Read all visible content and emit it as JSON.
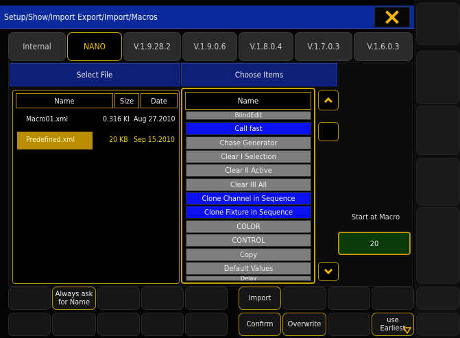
{
  "window": {
    "title": "Setup/Show/Import Export/Import/Macros"
  },
  "tabs": [
    {
      "label": "Internal"
    },
    {
      "label": "NANO"
    },
    {
      "label": "V.1.9.28.2"
    },
    {
      "label": "V.1.9.0.6"
    },
    {
      "label": "V.1.8.0.4"
    },
    {
      "label": "V.1.7.0.3"
    },
    {
      "label": "V.1.6.0.3"
    }
  ],
  "headers": {
    "select_file": "Select File",
    "choose_items": "Choose Items"
  },
  "file_table": {
    "columns": [
      "Name",
      "Size",
      "Date"
    ],
    "rows": [
      {
        "name": "Macro01.xml",
        "size": "0.316 KI",
        "date": "Aug 27.2010"
      },
      {
        "name": "Predefined.xml",
        "size": "20 KB",
        "date": "Sep 15.2010"
      }
    ]
  },
  "items": {
    "header": "Name",
    "rows": [
      "BlindEdit",
      "Call fast",
      "Chase Generator",
      "Clear I Selection",
      "Clear II Active",
      "Clear III All",
      "Clone Channel in Sequence",
      "Clone Fixture in Sequence",
      "COLOR",
      "CONTROL",
      "Copy",
      "Default Values",
      "Delay"
    ]
  },
  "start_at": {
    "label": "Start at Macro",
    "value": "20"
  },
  "bottom": {
    "always_ask": "Always ask for Name",
    "import": "Import",
    "confirm": "Confirm",
    "overwrite": "Overwrite",
    "use_earliest": "use Earliest"
  },
  "colors": {
    "accent": "#c8a200",
    "title_bg": "#0b2a9c",
    "selected_item": "#0a10ee",
    "item_bg": "#7d7d7d",
    "start_box": "#0a3a0a"
  }
}
